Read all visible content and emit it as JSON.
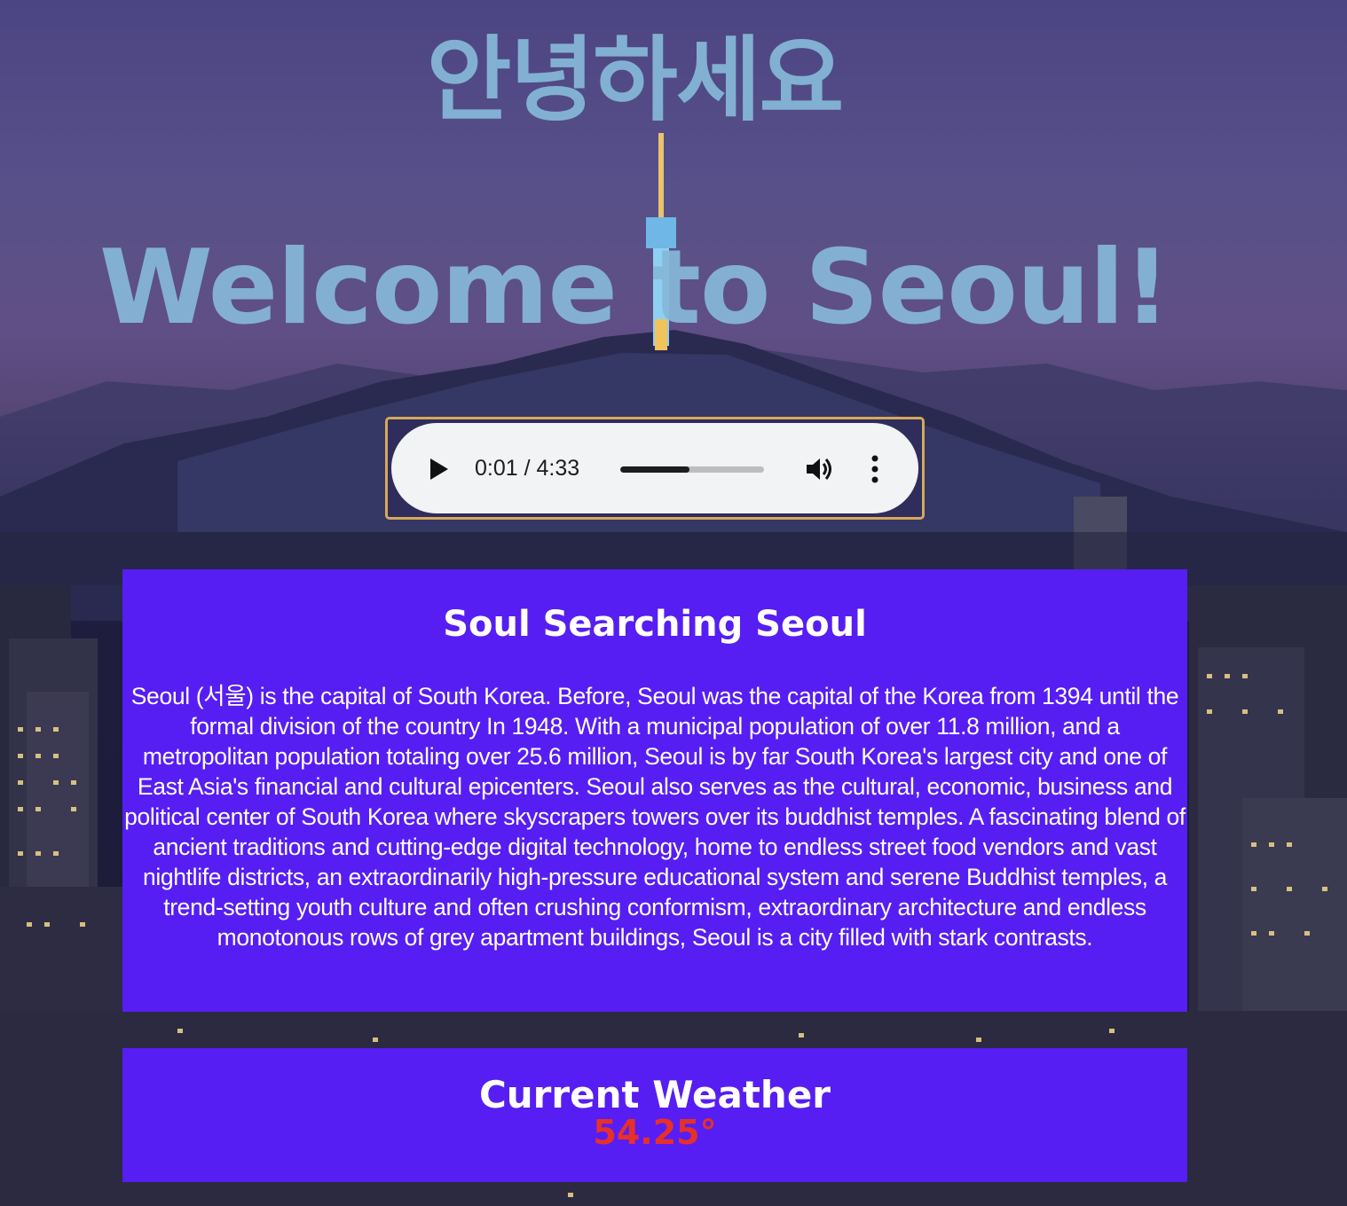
{
  "header": {
    "greeting": "안녕하세요",
    "title": "Welcome to Seoul!"
  },
  "audio_player": {
    "time_display": "0:01 / 4:33",
    "progress_fraction": 0.48
  },
  "about": {
    "title": "Soul Searching Seoul",
    "body": "Seoul (서울) is the capital of South Korea. Before, Seoul was the capital of the Korea from 1394 until the formal division of the country In 1948. With a municipal population of over 11.8 million, and a metropolitan population totaling over 25.6 million, Seoul is by far South Korea's largest city and one of East Asia's financial and cultural epicenters. Seoul also serves as the cultural, economic, business and political center of South Korea where skyscrapers towers over its buddhist temples. A fascinating blend of ancient traditions and cutting-edge digital technology, home to endless street food vendors and vast nightlife districts, an extraordinarily high-pressure educational system and serene Buddhist temples, a trend-setting youth culture and often crushing conformism, extraordinary architecture and endless monotonous rows of grey apartment buildings, Seoul is a city filled with stark contrasts."
  },
  "weather": {
    "title": "Current Weather",
    "temperature": "54.25°"
  },
  "colors": {
    "heading_text": "#86b8d8",
    "panel_background": "#561ef2",
    "temperature_text": "#e7302a",
    "player_border": "#d6a85a"
  },
  "icons": [
    "play-icon",
    "volume-icon",
    "more-options-icon"
  ]
}
